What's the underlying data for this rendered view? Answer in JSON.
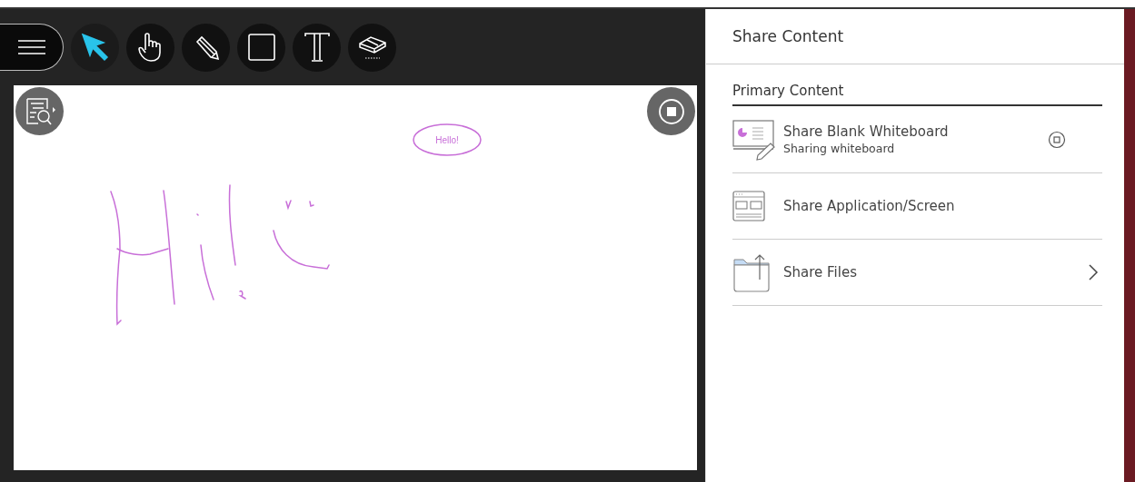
{
  "toolbar": {
    "tools": [
      {
        "kind": "pointer",
        "selected": true
      },
      {
        "kind": "hand",
        "selected": false
      },
      {
        "kind": "pencil",
        "selected": false
      },
      {
        "kind": "rectangle",
        "selected": false
      },
      {
        "kind": "text",
        "selected": false
      },
      {
        "kind": "eraser",
        "selected": false
      }
    ]
  },
  "whiteboard": {
    "bubble_text": "Hello!"
  },
  "panel": {
    "title": "Share Content",
    "section": "Primary Content",
    "items": [
      {
        "kind": "whiteboard",
        "label": "Share Blank Whiteboard",
        "subtitle": "Sharing whiteboard",
        "stop_button": true
      },
      {
        "kind": "screen",
        "label": "Share Application/Screen"
      },
      {
        "kind": "files",
        "label": "Share Files",
        "chevron": true
      }
    ]
  }
}
